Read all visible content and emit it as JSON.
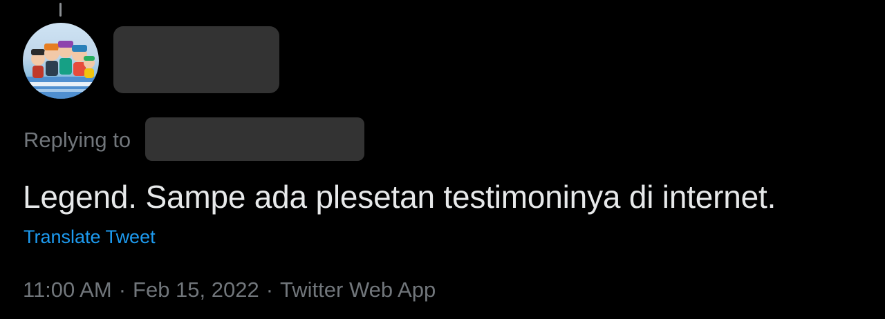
{
  "tweet": {
    "replying_label": "Replying to",
    "text": "Legend. Sampe ada plesetan testimoninya di internet.",
    "translate_label": "Translate Tweet",
    "time": "11:00 AM",
    "date": "Feb 15, 2022",
    "source": "Twitter Web App",
    "separator": "·"
  },
  "colors": {
    "background": "#000000",
    "text_primary": "#e7e9ea",
    "text_secondary": "#71767b",
    "link": "#1d9bf0",
    "redaction": "#333333"
  },
  "icons": {
    "avatar": "cartoon-group-avatar"
  }
}
